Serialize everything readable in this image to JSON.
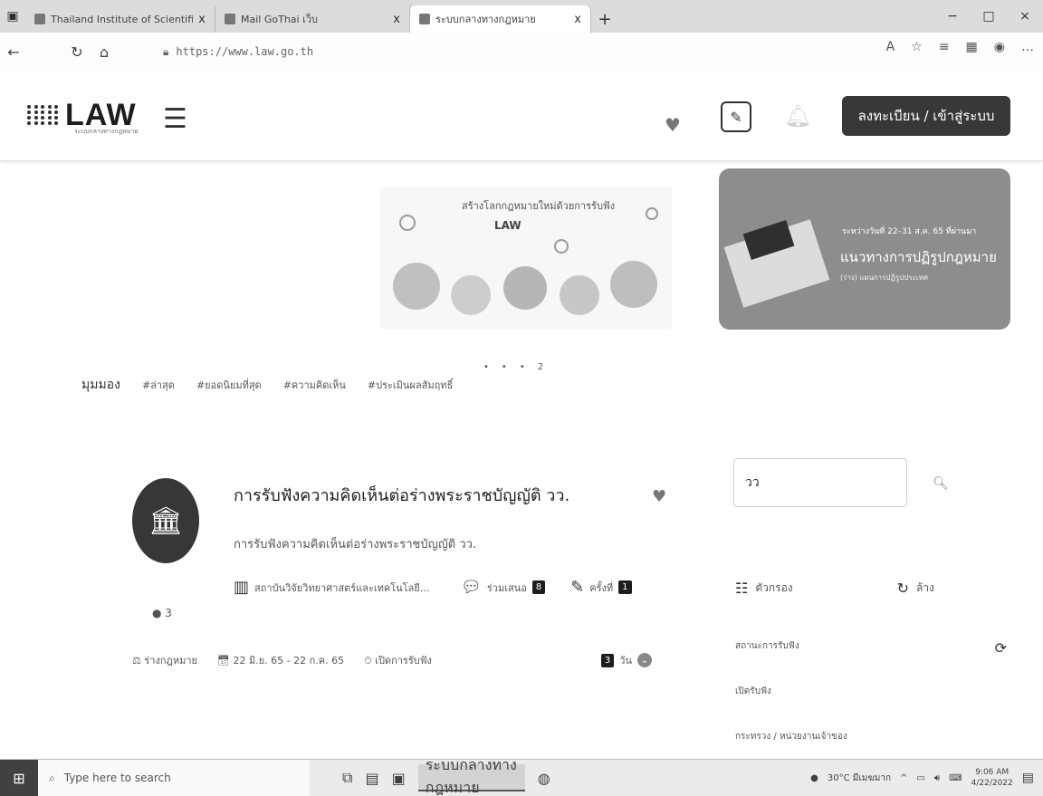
{
  "browser": {
    "tabs": [
      {
        "title": "Thailand Institute of Scientific a"
      },
      {
        "title": "Mail GoThai เว็บ"
      },
      {
        "title": "ระบบกลางทางกฎหมาย"
      }
    ],
    "close_glyph": "x",
    "new_tab_glyph": "+",
    "url": "https://www.law.go.th",
    "window_controls": [
      "−",
      "□",
      "×"
    ]
  },
  "header": {
    "logo_text": "LAW",
    "logo_subtitle": "ระบบกลางทางกฎหมาย",
    "login_button": "ลงทะเบียน / เข้าสู่ระบบ"
  },
  "banners": {
    "left_line1": "สร้างโลกกฎหมายใหม่ด้วยการรับฟัง",
    "left_line2": "LAW",
    "right_line1": "ระหว่างวันที่ 22–31 ส.ค. 65 ที่ผ่านมา",
    "right_line2": "แนวทางการปฏิรูปกฎหมาย",
    "right_line3": "(ร่าง) แผนการปฏิรูปประเทศ"
  },
  "carousel": {
    "dots": [
      "•",
      "•",
      "•",
      "2"
    ]
  },
  "tags": {
    "label": "มุมมอง",
    "items": [
      "#ล่าสุด",
      "#ยอดนิยมที่สุด",
      "#ความคิดเห็น",
      "#ประเมินผลสัมฤทธิ์"
    ]
  },
  "card": {
    "title": "การรับฟังความคิดเห็นต่อร่างพระราชบัญญัติ วว.",
    "description": "การรับฟังความคิดเห็นต่อร่างพระราชบัญญัติ วว.",
    "avatar_caption": "3",
    "agency": "สถาบันวิจัยวิทยาศาสตร์และเทคโนโลยีแห่งประเทศไทย",
    "comments_label": "ร่วมเสนอ",
    "comments_count": "8",
    "edits_label": "ครั้งที่",
    "edits_count": "1",
    "status": "ร่างกฎหมาย",
    "date_range": "22 มิ.ย. 65 - 22 ก.ค. 65",
    "phase": "เปิดการรับฟัง",
    "days_count": "3",
    "days_label": "วัน"
  },
  "sidebar": {
    "search_value": "วว",
    "filter_label": "ตัวกรอง",
    "sort_label": "ล้าง",
    "list": [
      "สถานะการรับฟัง",
      "เปิดรับฟัง",
      "กระทรวง / หน่วยงานเจ้าของ"
    ]
  },
  "taskbar": {
    "search_placeholder": "Type here to search",
    "app_label": "ระบบกลางทางกฎหมาย",
    "weather": "30°C มีเมฆมาก",
    "time": "9:06 AM",
    "date": "4/22/2022"
  }
}
